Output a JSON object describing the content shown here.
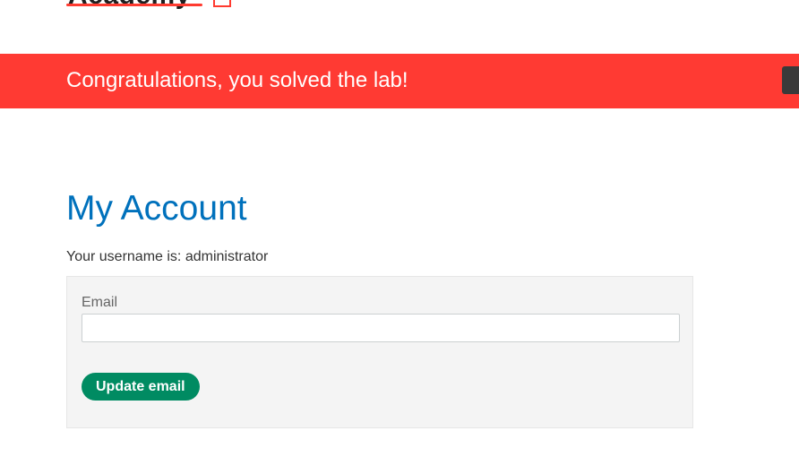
{
  "header": {
    "logo_text": "Academy"
  },
  "banner": {
    "message": "Congratulations, you solved the lab!"
  },
  "account": {
    "title": "My Account",
    "username_line": "Your username is: administrator"
  },
  "form": {
    "email_label": "Email",
    "email_value": "",
    "submit_label": "Update email"
  },
  "colors": {
    "banner_bg": "#ff3a33",
    "title": "#0071bc",
    "button_bg": "#008b62",
    "logo_accent": "#ff3b30"
  }
}
